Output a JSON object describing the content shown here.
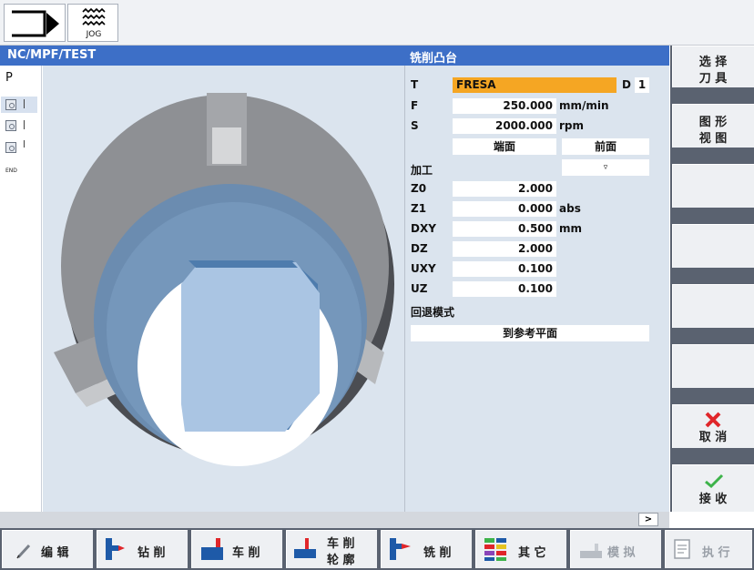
{
  "topbar": {
    "mode_icon": "program-manager-icon",
    "jog_icon": "jog-wave-icon",
    "jog_label": "JOG"
  },
  "header": {
    "path": "NC/MPF/TEST",
    "title": "铣削凸台"
  },
  "leftcol": {
    "p_label": "P",
    "end_label": "END"
  },
  "form": {
    "T": {
      "label": "T",
      "value": "FRESA",
      "d_label": "D",
      "d_value": "1"
    },
    "F": {
      "label": "F",
      "value": "250.000",
      "unit": "mm/min"
    },
    "S": {
      "label": "S",
      "value": "2000.000",
      "unit": "rpm"
    },
    "plane_left": "端面",
    "plane_right": "前面",
    "machining": {
      "label": "加工",
      "value": "▿"
    },
    "Z0": {
      "label": "Z0",
      "value": "2.000"
    },
    "Z1": {
      "label": "Z1",
      "value": "0.000",
      "unit": "abs"
    },
    "DXY": {
      "label": "DXY",
      "value": "0.500",
      "unit": "mm"
    },
    "DZ": {
      "label": "DZ",
      "value": "2.000"
    },
    "UXY": {
      "label": "UXY",
      "value": "0.100"
    },
    "UZ": {
      "label": "UZ",
      "value": "0.100"
    },
    "retract": {
      "label": "回退模式",
      "value": "到参考平面"
    }
  },
  "right_softkeys": {
    "select_tool_l1": "选 择",
    "select_tool_l2": "刀 具",
    "graphic_view_l1": "图 形",
    "graphic_view_l2": "视 图",
    "cancel": "取 消",
    "accept": "接 收"
  },
  "status": {
    "more": ">"
  },
  "bottom_softkeys": {
    "edit": "编 辑",
    "drill": "钻 削",
    "turn": "车 削",
    "contour_l1": "车 削",
    "contour_l2": "轮 廓",
    "mill": "铣 削",
    "other": "其 它",
    "simulate": "模 拟",
    "execute": "执 行"
  },
  "colors": {
    "header_blue": "#3d6fc7",
    "tool_orange": "#f5a623",
    "cancel_red": "#e0262a",
    "accept_green": "#3db34a"
  }
}
